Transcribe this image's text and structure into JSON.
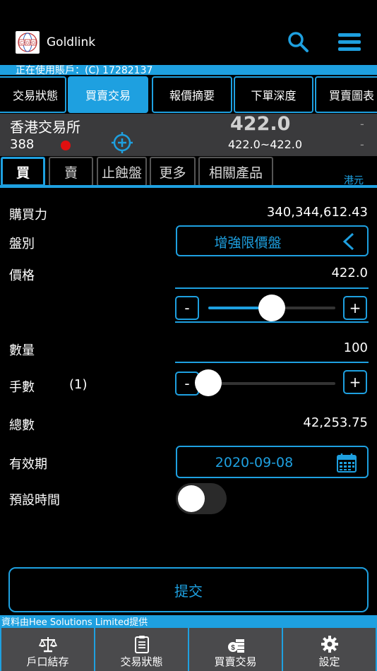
{
  "header": {
    "app_title": "Goldlink",
    "logo_text": "CGG"
  },
  "account": {
    "text": "正在使用賬戶：(C) 17282137"
  },
  "main_tabs": [
    {
      "label": "交易狀態",
      "active": false
    },
    {
      "label": "買賣交易",
      "active": true
    },
    {
      "label": "報價摘要",
      "active": false
    },
    {
      "label": "下單深度",
      "active": false
    },
    {
      "label": "買賣圖表",
      "active": false
    }
  ],
  "quote": {
    "exchange": "香港交易所",
    "code": "388",
    "price": "422.0",
    "range": "422.0~422.0",
    "dash1": "-",
    "dash2": "-"
  },
  "sub_tabs": [
    {
      "label": "買",
      "active": true
    },
    {
      "label": "賣",
      "active": false
    },
    {
      "label": "止蝕盤",
      "active": false
    },
    {
      "label": "更多",
      "active": false
    },
    {
      "label": "相關產品",
      "active": false
    }
  ],
  "currency": "港元",
  "form": {
    "buying_power_label": "購買力",
    "buying_power_value": "340,344,612.43",
    "order_type_label": "盤別",
    "order_type_value": "增強限價盤",
    "price_label": "價格",
    "price_value": "422.0",
    "price_slider_fraction": 0.5,
    "quantity_label": "數量",
    "quantity_value": "100",
    "lots_label": "手數",
    "lots_value": "(1)",
    "lots_slider_fraction": 0.0,
    "total_label": "總數",
    "total_value": "42,253.75",
    "validity_label": "有效期",
    "validity_value": "2020-09-08",
    "preset_time_label": "預設時間",
    "preset_time_on": false,
    "minus": "-",
    "plus": "+"
  },
  "submit_label": "提交",
  "footer_text": "資料由Hee Solutions Limited提供",
  "bottom_nav": [
    {
      "label": "戶口結存",
      "icon": "scale-icon"
    },
    {
      "label": "交易狀態",
      "icon": "clipboard-icon"
    },
    {
      "label": "買賣交易",
      "icon": "money-icon"
    },
    {
      "label": "設定",
      "icon": "gear-icon"
    }
  ],
  "colors": {
    "accent": "#1ea0e0",
    "background": "#000000",
    "panel": "#3a3a3c",
    "alert": "#e01010"
  }
}
